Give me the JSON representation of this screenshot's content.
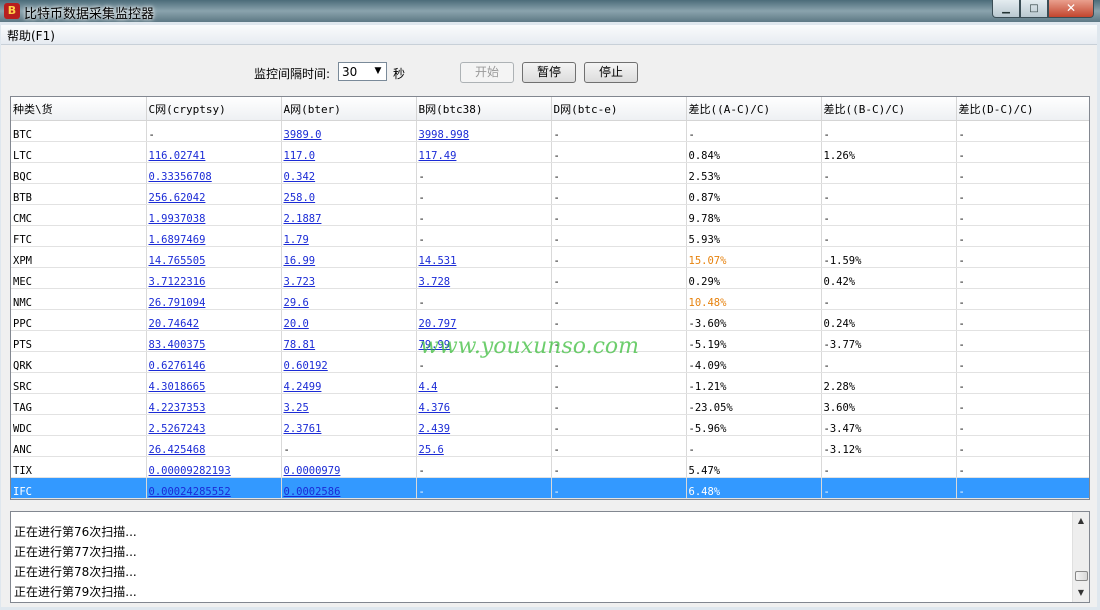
{
  "window": {
    "title": "比特币数据采集监控器",
    "icon": "app-icon",
    "min_glyph": "▁",
    "max_glyph": "□",
    "close_glyph": "✕"
  },
  "menu": {
    "help": "帮助(F1)"
  },
  "controls": {
    "interval_label": "监控间隔时间:",
    "interval_value": "30",
    "interval_unit": "秒",
    "start": "开始",
    "pause": "暂停",
    "stop": "停止"
  },
  "table": {
    "columns": [
      "种类\\货",
      "C网(cryptsy)",
      "A网(bter)",
      "B网(btc38)",
      "D网(btc-e)",
      "差比((A-C)/C)",
      "差比((B-C)/C)",
      "差比(D-C)/C)"
    ],
    "rows": [
      [
        "BTC",
        "-",
        "3989.0",
        "3998.998",
        "-",
        "-",
        "-",
        "-"
      ],
      [
        "LTC",
        "116.02741",
        "117.0",
        "117.49",
        "-",
        "0.84%",
        "1.26%",
        "-"
      ],
      [
        "BQC",
        "0.33356708",
        "0.342",
        "-",
        "-",
        "2.53%",
        "-",
        "-"
      ],
      [
        "BTB",
        "256.62042",
        "258.0",
        "-",
        "-",
        "0.87%",
        "-",
        "-"
      ],
      [
        "CMC",
        "1.9937038",
        "2.1887",
        "-",
        "-",
        "9.78%",
        "-",
        "-"
      ],
      [
        "FTC",
        "1.6897469",
        "1.79",
        "-",
        "-",
        "5.93%",
        "-",
        "-"
      ],
      [
        "XPM",
        "14.765505",
        "16.99",
        "14.531",
        "-",
        "15.07%",
        "-1.59%",
        "-"
      ],
      [
        "MEC",
        "3.7122316",
        "3.723",
        "3.728",
        "-",
        "0.29%",
        "0.42%",
        "-"
      ],
      [
        "NMC",
        "26.791094",
        "29.6",
        "-",
        "-",
        "10.48%",
        "-",
        "-"
      ],
      [
        "PPC",
        "20.74642",
        "20.0",
        "20.797",
        "-",
        "-3.60%",
        "0.24%",
        "-"
      ],
      [
        "PTS",
        "83.400375",
        "78.81",
        "79.99",
        "-",
        "-5.19%",
        "-3.77%",
        "-"
      ],
      [
        "QRK",
        "0.6276146",
        "0.60192",
        "-",
        "-",
        "-4.09%",
        "-",
        "-"
      ],
      [
        "SRC",
        "4.3018665",
        "4.2499",
        "4.4",
        "-",
        "-1.21%",
        "2.28%",
        "-"
      ],
      [
        "TAG",
        "4.2237353",
        "3.25",
        "4.376",
        "-",
        "-23.05%",
        "3.60%",
        "-"
      ],
      [
        "WDC",
        "2.5267243",
        "2.3761",
        "2.439",
        "-",
        "-5.96%",
        "-3.47%",
        "-"
      ],
      [
        "ANC",
        "26.425468",
        "-",
        "25.6",
        "-",
        "-",
        "-3.12%",
        "-"
      ],
      [
        "TIX",
        "0.00009282193",
        "0.0000979",
        "-",
        "-",
        "5.47%",
        "-",
        "-"
      ],
      [
        "IFC",
        "0.00024285552",
        "0.0002586",
        "-",
        "-",
        "6.48%",
        "-",
        "-"
      ]
    ],
    "selected_row": 17,
    "highlight_color": "#e6820e"
  },
  "watermark": "www.youxunso.com",
  "log": {
    "lines": [
      "正在进行第76次扫描...",
      "正在进行第77次扫描...",
      "正在进行第78次扫描...",
      "正在进行第79次扫描..."
    ]
  }
}
